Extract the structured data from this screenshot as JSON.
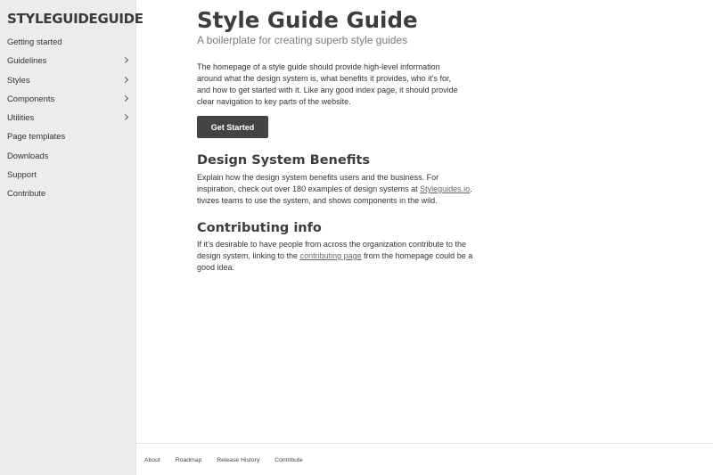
{
  "sidebar": {
    "logo": "STYLEGUIDEGUIDE",
    "items": [
      {
        "label": "Getting started",
        "has_submenu": false
      },
      {
        "label": "Guidelines",
        "has_submenu": true
      },
      {
        "label": "Styles",
        "has_submenu": true
      },
      {
        "label": "Components",
        "has_submenu": true
      },
      {
        "label": "Utilities",
        "has_submenu": true
      },
      {
        "label": "Page templates",
        "has_submenu": false
      },
      {
        "label": "Downloads",
        "has_submenu": false
      },
      {
        "label": "Support",
        "has_submenu": false
      },
      {
        "label": "Contribute",
        "has_submenu": false
      }
    ],
    "chevron_icon": "chevron-right-icon"
  },
  "main": {
    "title": "Style Guide Guide",
    "subtitle": "A boilerplate for creating superb style guides",
    "intro": "The homepage of a style guide should provide high-level information around what the design system is, what benefits it provides, who it’s for, and how to get started with it. Like any good index page, it should provide clear navigation to key parts of the website.",
    "cta_label": "Get Started",
    "benefits": {
      "heading": "Design System Benefits",
      "text_before": "Explain how the design system benefits users and the business. For inspiration, check out over 180 examples of design systems at ",
      "link": "Styleguides.io",
      "text_after": ". tivizes teams to use the system, and shows components in the wild."
    },
    "contributing": {
      "heading": "Contributing info",
      "text_before": "If it’s desirable to have people from across the organization contribute to the design system, linking to the ",
      "link": "contributing page",
      "text_after": " from the homepage could be a good idea."
    }
  },
  "footer": {
    "links": [
      "About",
      "Roadmap",
      "Release History",
      "Contribute"
    ]
  },
  "colors": {
    "sidebar_bg": "#ececec",
    "button_bg": "#444444",
    "text": "#333333",
    "subtitle": "#7a7a7a"
  }
}
